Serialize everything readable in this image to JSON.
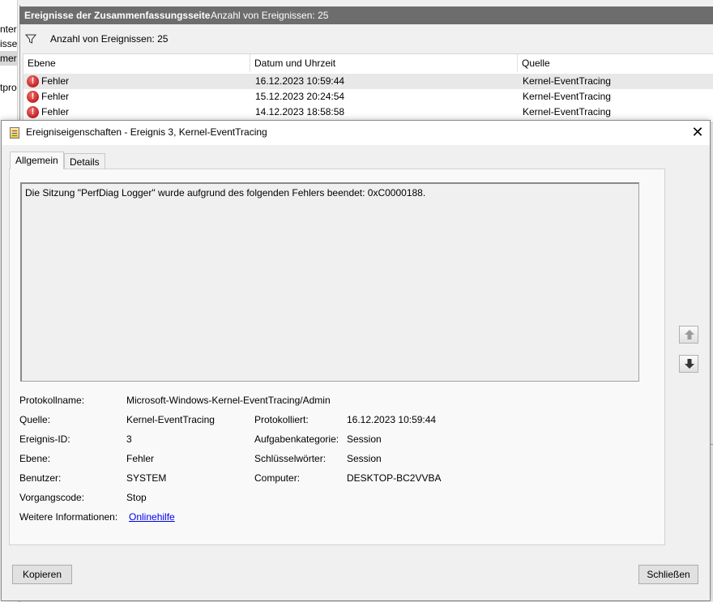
{
  "background_window": {
    "left_fragments": [
      "nter",
      "isse",
      "mer",
      "tpro"
    ],
    "header_title": "Ereignisse der Zusammenfassungsseite",
    "header_count": "Anzahl von Ereignissen: 25",
    "filter_text": "Anzahl von Ereignissen: 25",
    "columns": [
      "Ebene",
      "Datum und Uhrzeit",
      "Quelle"
    ],
    "rows": [
      {
        "level": "Fehler",
        "datetime": "16.12.2023 10:59:44",
        "source": "Kernel-EventTracing"
      },
      {
        "level": "Fehler",
        "datetime": "15.12.2023 20:24:54",
        "source": "Kernel-EventTracing"
      },
      {
        "level": "Fehler",
        "datetime": "14.12.2023 18:58:58",
        "source": "Kernel-EventTracing"
      }
    ]
  },
  "dialog": {
    "title": "Ereigniseigenschaften - Ereignis 3, Kernel-EventTracing",
    "close_glyph": "✕",
    "tabs": [
      "Allgemein",
      "Details"
    ],
    "active_tab": "Allgemein",
    "message": "Die Sitzung \"PerfDiag Logger\" wurde aufgrund des folgenden Fehlers beendet: 0xC0000188.",
    "fields": {
      "protokollname_label": "Protokollname:",
      "protokollname_value": "Microsoft-Windows-Kernel-EventTracing/Admin",
      "quelle_label": "Quelle:",
      "quelle_value": "Kernel-EventTracing",
      "protokolliert_label": "Protokolliert:",
      "protokolliert_value": "16.12.2023 10:59:44",
      "ereignis_id_label": "Ereignis-ID:",
      "ereignis_id_value": "3",
      "aufgabenkategorie_label": "Aufgabenkategorie:",
      "aufgabenkategorie_value": "Session",
      "ebene_label": "Ebene:",
      "ebene_value": "Fehler",
      "schluesselwoerter_label": "Schlüsselwörter:",
      "schluesselwoerter_value": "Session",
      "benutzer_label": "Benutzer:",
      "benutzer_value": "SYSTEM",
      "computer_label": "Computer:",
      "computer_value": "DESKTOP-BC2VVBA",
      "vorgangscode_label": "Vorgangscode:",
      "vorgangscode_value": "Stop",
      "weitere_label": "Weitere Informationen:",
      "weitere_link": "Onlinehilfe"
    },
    "buttons": {
      "copy": "Kopieren",
      "close": "Schließen"
    },
    "icons": {
      "prev": "arrow-up-icon",
      "next": "arrow-down-icon"
    }
  }
}
